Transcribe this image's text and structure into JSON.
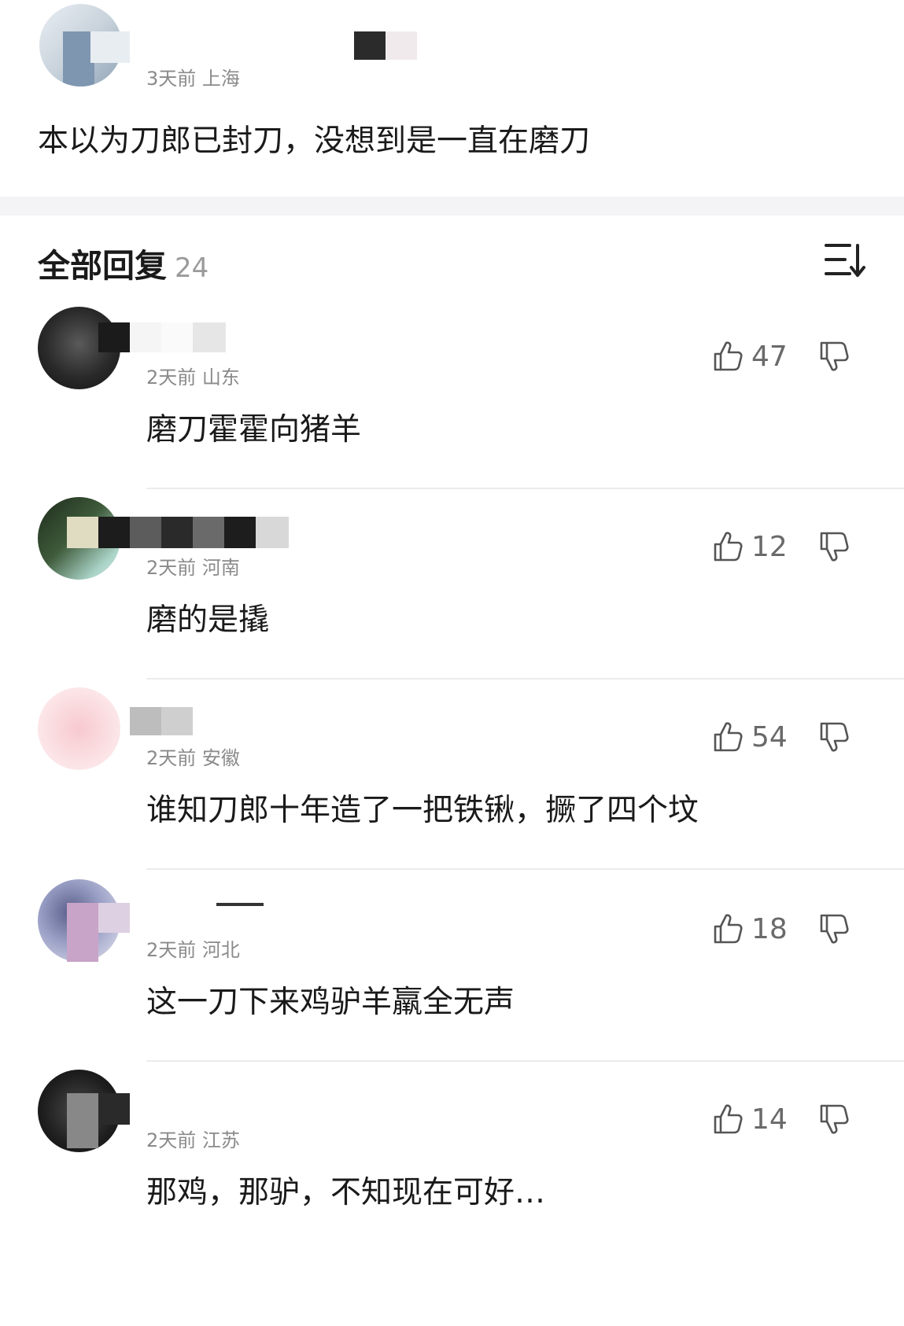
{
  "original_comment": {
    "username": "…",
    "meta": "3天前 上海",
    "content": "本以为刀郎已封刀，没想到是一直在磨刀"
  },
  "replies_header": {
    "title": "全部回复",
    "count": "24",
    "sort_icon": "sort-icon"
  },
  "replies": [
    {
      "meta": "2天前 山东",
      "content": "磨刀霍霍向猪羊",
      "likes": "47"
    },
    {
      "meta": "2天前 河南",
      "content": "磨的是撬",
      "likes": "12"
    },
    {
      "meta": "2天前 安徽",
      "content": "谁知刀郎十年造了一把铁锹，撅了四个坟",
      "likes": "54"
    },
    {
      "meta": "2天前 河北",
      "content": "这一刀下来鸡驴羊羸全无声",
      "likes": "18"
    },
    {
      "meta": "2天前 江苏",
      "content": "那鸡，那驴，不知现在可好…",
      "likes": "14"
    }
  ],
  "icons": {
    "like": "thumbs-up-icon",
    "dislike": "thumbs-down-icon"
  }
}
